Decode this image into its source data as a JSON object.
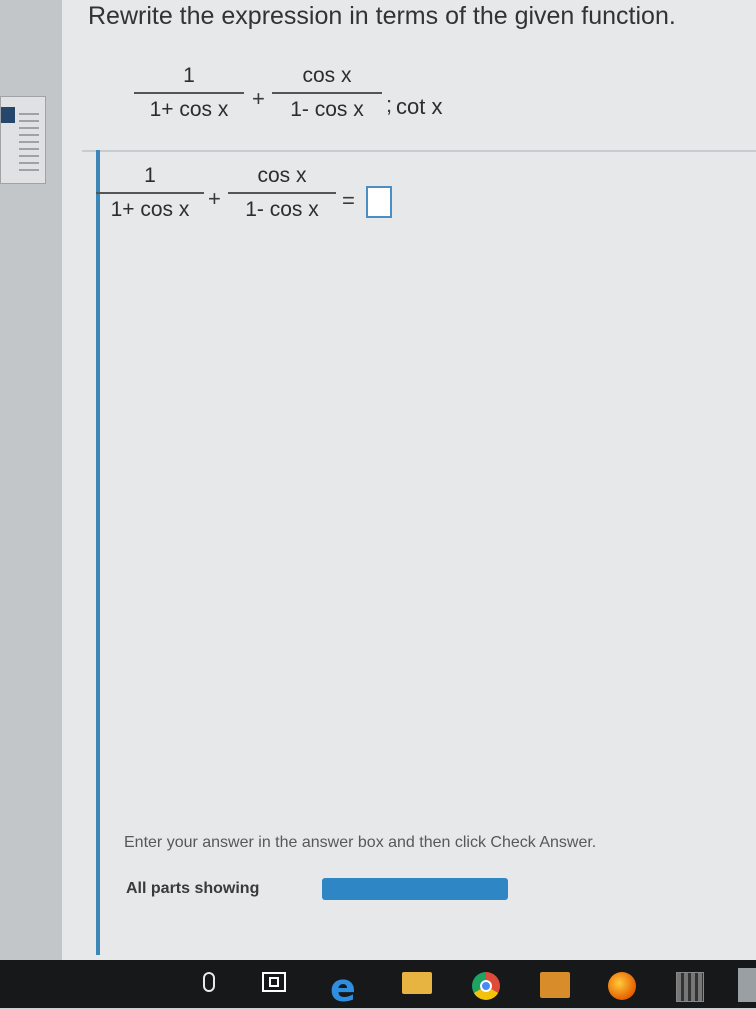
{
  "question": {
    "prompt": "Rewrite the expression in terms of the given function.",
    "given": {
      "frac1": {
        "num": "1",
        "den": "1+ cos x"
      },
      "plus": "+",
      "frac2": {
        "num": "cos x",
        "den": "1- cos x"
      },
      "separator": ";",
      "function": "cot x"
    },
    "equation": {
      "frac1": {
        "num": "1",
        "den": "1+ cos x"
      },
      "plus": "+",
      "frac2": {
        "num": "cos x",
        "den": "1- cos x"
      },
      "equals": "="
    }
  },
  "footer": {
    "instruction": "Enter your answer in the answer box and then click Check Answer.",
    "parts_label": "All parts showing"
  },
  "taskbar": {
    "icons": [
      "microphone-icon",
      "task-view-icon",
      "edge-icon",
      "file-explorer-icon",
      "chrome-icon",
      "store-icon",
      "firefox-icon",
      "calculator-icon"
    ],
    "edge_glyph": "e"
  }
}
